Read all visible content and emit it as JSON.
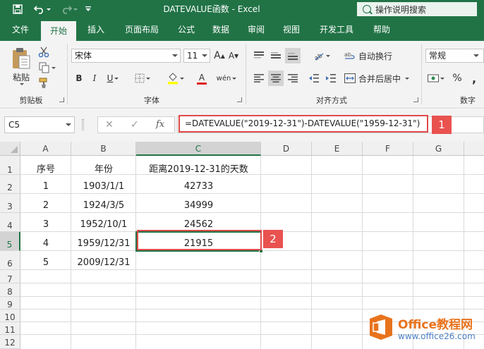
{
  "title_bar": {
    "title": "DATEVALUE函数  -  Excel",
    "tell_me": "操作说明搜索",
    "accent": "#217346"
  },
  "tabs": [
    "文件",
    "开始",
    "插入",
    "页面布局",
    "公式",
    "数据",
    "审阅",
    "视图",
    "开发工具",
    "帮助"
  ],
  "active_tab": "开始",
  "ribbon": {
    "clipboard": {
      "paste": "粘贴",
      "group": "剪贴板"
    },
    "font": {
      "name": "宋体",
      "size": "11",
      "grow": "A",
      "shrink": "A",
      "bold": "B",
      "italic": "I",
      "underline": "U",
      "color_a": "A",
      "wen": "wén",
      "group": "字体"
    },
    "alignment": {
      "wrap": "自动换行",
      "merge": "合并后居中",
      "group": "对齐方式"
    },
    "number": {
      "format": "常规",
      "percent": "%",
      "group": "数字"
    }
  },
  "formula_bar": {
    "name_box": "C5",
    "cancel": "✕",
    "enter": "✓",
    "fx": "fx",
    "formula": "=DATEVALUE(\"2019-12-31\")-DATEVALUE(\"1959-12-31\")"
  },
  "callouts": [
    "1",
    "2"
  ],
  "sheet": {
    "columns": [
      "A",
      "B",
      "C",
      "D",
      "E",
      "F",
      "G"
    ],
    "selected_column": "C",
    "rows": [
      "1",
      "2",
      "3",
      "4",
      "5",
      "6",
      "7",
      "8",
      "9",
      "10",
      "11",
      "12"
    ],
    "selected_row": "5",
    "cells": {
      "A1": "序号",
      "B1": "年份",
      "C1": "距离2019-12-31的天数",
      "A2": "1",
      "B2": "1903/1/1",
      "C2": "42733",
      "A3": "2",
      "B3": "1924/3/5",
      "C3": "34999",
      "A4": "3",
      "B4": "1952/10/1",
      "C4": "24562",
      "A5": "4",
      "B5": "1959/12/31",
      "C5": "21915",
      "A6": "5",
      "B6": "2009/12/31"
    }
  },
  "watermark": {
    "brand": "Office教程网",
    "url": "www.office26.com"
  }
}
